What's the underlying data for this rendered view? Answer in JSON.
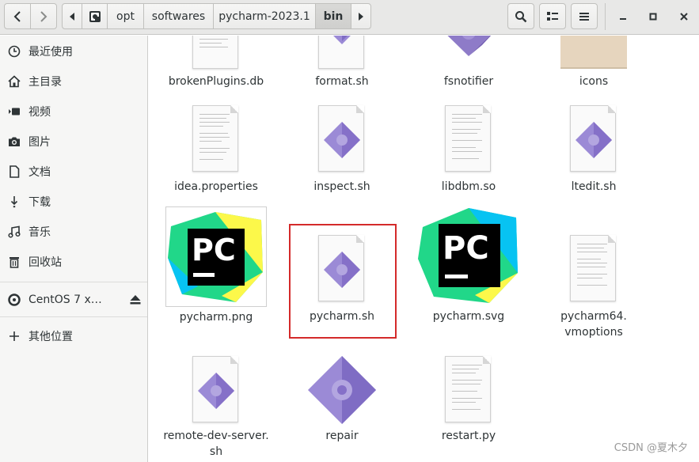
{
  "breadcrumb": {
    "items": [
      "opt",
      "softwares",
      "pycharm-2023.1",
      "bin"
    ]
  },
  "sidebar": {
    "items": [
      {
        "label": "最近使用",
        "icon": "clock-icon"
      },
      {
        "label": "主目录",
        "icon": "home-icon"
      },
      {
        "label": "视频",
        "icon": "video-icon"
      },
      {
        "label": "图片",
        "icon": "camera-icon"
      },
      {
        "label": "文档",
        "icon": "document-icon"
      },
      {
        "label": "下载",
        "icon": "download-icon"
      },
      {
        "label": "音乐",
        "icon": "music-icon"
      },
      {
        "label": "回收站",
        "icon": "trash-icon"
      }
    ],
    "device": {
      "label": "CentOS 7 x…",
      "icon": "disc-icon",
      "action_icon": "eject-icon"
    },
    "other": {
      "label": "其他位置",
      "icon": "plus-icon"
    }
  },
  "files": [
    {
      "name": "brokenPlugins.db",
      "type": "text"
    },
    {
      "name": "format.sh",
      "type": "script"
    },
    {
      "name": "fsnotifier",
      "type": "executable"
    },
    {
      "name": "icons",
      "type": "folder"
    },
    {
      "name": "idea.properties",
      "type": "text"
    },
    {
      "name": "inspect.sh",
      "type": "script"
    },
    {
      "name": "libdbm.so",
      "type": "text"
    },
    {
      "name": "ltedit.sh",
      "type": "script"
    },
    {
      "name": "pycharm.png",
      "type": "image",
      "logo_text": "PC"
    },
    {
      "name": "pycharm.sh",
      "type": "script",
      "selected": true
    },
    {
      "name": "pycharm.svg",
      "type": "image",
      "logo_text": "PC"
    },
    {
      "name": "pycharm64.\nvmoptions",
      "type": "text"
    },
    {
      "name": "remote-dev-server.\nsh",
      "type": "script"
    },
    {
      "name": "repair",
      "type": "executable"
    },
    {
      "name": "restart.py",
      "type": "text"
    }
  ],
  "watermark": "CSDN @夏木夕",
  "colors": {
    "selection_border": "#d42a2a",
    "script_icon": "#9b8ad6",
    "folder": "#e6d5be"
  }
}
